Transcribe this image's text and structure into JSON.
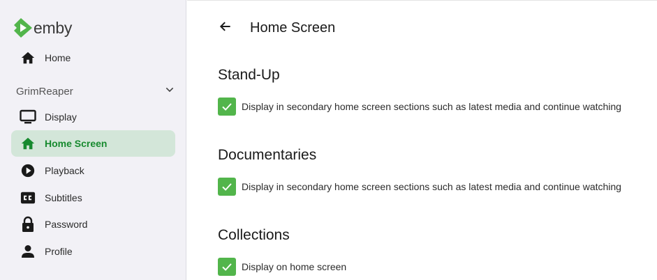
{
  "app": {
    "logo_text": "emby",
    "brand_color": "#52b54b"
  },
  "sidebar": {
    "home": {
      "label": "Home",
      "icon": "home-icon"
    },
    "user": {
      "name": "GrimReaper",
      "icon": "chevron-down-icon"
    },
    "items": [
      {
        "label": "Display",
        "icon": "monitor-icon",
        "active": false
      },
      {
        "label": "Home Screen",
        "icon": "home-icon",
        "active": true
      },
      {
        "label": "Playback",
        "icon": "play-circle-icon",
        "active": false
      },
      {
        "label": "Subtitles",
        "icon": "closed-captions-icon",
        "active": false
      },
      {
        "label": "Password",
        "icon": "lock-icon",
        "active": false
      },
      {
        "label": "Profile",
        "icon": "person-icon",
        "active": false
      }
    ]
  },
  "main": {
    "title": "Home Screen",
    "back_icon": "arrow-left-icon",
    "libraries": [
      {
        "name": "Stand-Up",
        "option": {
          "label": "Display in secondary home screen sections such as latest media and continue watching",
          "checked": true
        }
      },
      {
        "name": "Documentaries",
        "option": {
          "label": "Display in secondary home screen sections such as latest media and continue watching",
          "checked": true
        }
      },
      {
        "name": "Collections",
        "option": {
          "label": "Display on home screen",
          "checked": true
        }
      }
    ]
  }
}
